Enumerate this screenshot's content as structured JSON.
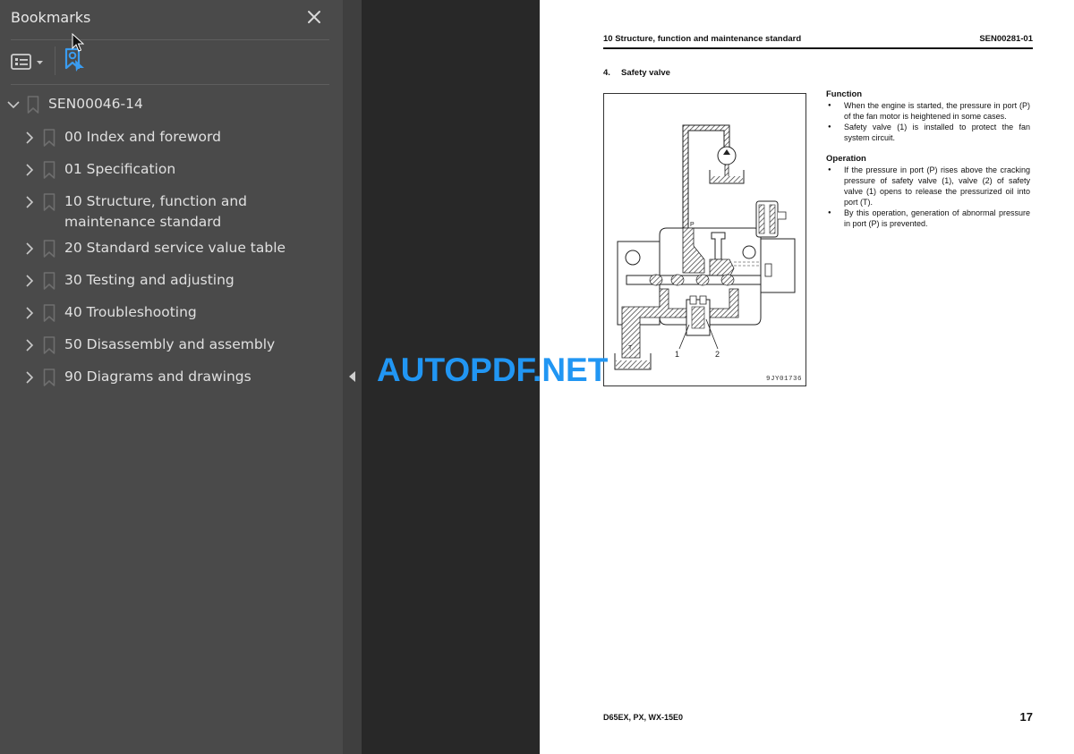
{
  "sidebar": {
    "title": "Bookmarks",
    "close_icon": "close-icon",
    "toolbar": {
      "options_icon": "list-options-icon",
      "find_bookmark_icon": "bookmark-find-icon",
      "accent": "#3a9cf0"
    },
    "root": {
      "label": "SEN00046-14",
      "expanded": true
    },
    "items": [
      {
        "label": "00 Index and foreword"
      },
      {
        "label": "01 Specification"
      },
      {
        "label": "10 Structure, function and maintenance standard"
      },
      {
        "label": "20 Standard service value table"
      },
      {
        "label": "30 Testing and adjusting"
      },
      {
        "label": "40 Troubleshooting"
      },
      {
        "label": "50 Disassembly and assembly"
      },
      {
        "label": "90 Diagrams and drawings"
      }
    ]
  },
  "splitter": {
    "collapse_icon": "caret-left-icon"
  },
  "page": {
    "header_left": "10 Structure, function and maintenance standard",
    "header_right": "SEN00281-01",
    "section_number": "4.",
    "section_title": "Safety valve",
    "figure": {
      "id": "9JY01736",
      "label_1": "1",
      "label_2": "2",
      "label_P": "P",
      "label_T": "T"
    },
    "function": {
      "heading": "Function",
      "bullets": [
        "When the engine is started, the pressure in port (P) of the fan motor is heightened in some cases.",
        "Safety valve (1) is installed to protect the fan system circuit."
      ]
    },
    "operation": {
      "heading": "Operation",
      "bullets": [
        "If the pressure in port (P) rises above the cracking pressure of safety valve (1), valve (2) of safety valve (1) opens to release the pressurized oil into port (T).",
        "By this operation, generation of abnormal pressure in port (P) is prevented."
      ]
    },
    "footer_left": "D65EX, PX, WX-15E0",
    "page_number": "17"
  },
  "watermark": {
    "text": "AUTOPDF.NET",
    "color": "#2196f3"
  }
}
